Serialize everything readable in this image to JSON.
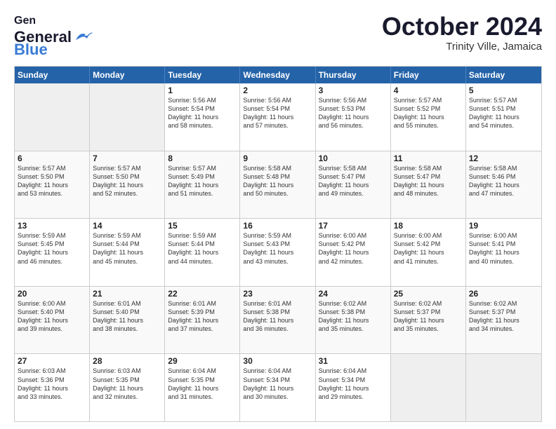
{
  "header": {
    "logo_line1": "General",
    "logo_line2": "Blue",
    "month_title": "October 2024",
    "location": "Trinity Ville, Jamaica"
  },
  "weekdays": [
    "Sunday",
    "Monday",
    "Tuesday",
    "Wednesday",
    "Thursday",
    "Friday",
    "Saturday"
  ],
  "rows": [
    [
      {
        "day": "",
        "info": ""
      },
      {
        "day": "",
        "info": ""
      },
      {
        "day": "1",
        "info": "Sunrise: 5:56 AM\nSunset: 5:54 PM\nDaylight: 11 hours\nand 58 minutes."
      },
      {
        "day": "2",
        "info": "Sunrise: 5:56 AM\nSunset: 5:54 PM\nDaylight: 11 hours\nand 57 minutes."
      },
      {
        "day": "3",
        "info": "Sunrise: 5:56 AM\nSunset: 5:53 PM\nDaylight: 11 hours\nand 56 minutes."
      },
      {
        "day": "4",
        "info": "Sunrise: 5:57 AM\nSunset: 5:52 PM\nDaylight: 11 hours\nand 55 minutes."
      },
      {
        "day": "5",
        "info": "Sunrise: 5:57 AM\nSunset: 5:51 PM\nDaylight: 11 hours\nand 54 minutes."
      }
    ],
    [
      {
        "day": "6",
        "info": "Sunrise: 5:57 AM\nSunset: 5:50 PM\nDaylight: 11 hours\nand 53 minutes."
      },
      {
        "day": "7",
        "info": "Sunrise: 5:57 AM\nSunset: 5:50 PM\nDaylight: 11 hours\nand 52 minutes."
      },
      {
        "day": "8",
        "info": "Sunrise: 5:57 AM\nSunset: 5:49 PM\nDaylight: 11 hours\nand 51 minutes."
      },
      {
        "day": "9",
        "info": "Sunrise: 5:58 AM\nSunset: 5:48 PM\nDaylight: 11 hours\nand 50 minutes."
      },
      {
        "day": "10",
        "info": "Sunrise: 5:58 AM\nSunset: 5:47 PM\nDaylight: 11 hours\nand 49 minutes."
      },
      {
        "day": "11",
        "info": "Sunrise: 5:58 AM\nSunset: 5:47 PM\nDaylight: 11 hours\nand 48 minutes."
      },
      {
        "day": "12",
        "info": "Sunrise: 5:58 AM\nSunset: 5:46 PM\nDaylight: 11 hours\nand 47 minutes."
      }
    ],
    [
      {
        "day": "13",
        "info": "Sunrise: 5:59 AM\nSunset: 5:45 PM\nDaylight: 11 hours\nand 46 minutes."
      },
      {
        "day": "14",
        "info": "Sunrise: 5:59 AM\nSunset: 5:44 PM\nDaylight: 11 hours\nand 45 minutes."
      },
      {
        "day": "15",
        "info": "Sunrise: 5:59 AM\nSunset: 5:44 PM\nDaylight: 11 hours\nand 44 minutes."
      },
      {
        "day": "16",
        "info": "Sunrise: 5:59 AM\nSunset: 5:43 PM\nDaylight: 11 hours\nand 43 minutes."
      },
      {
        "day": "17",
        "info": "Sunrise: 6:00 AM\nSunset: 5:42 PM\nDaylight: 11 hours\nand 42 minutes."
      },
      {
        "day": "18",
        "info": "Sunrise: 6:00 AM\nSunset: 5:42 PM\nDaylight: 11 hours\nand 41 minutes."
      },
      {
        "day": "19",
        "info": "Sunrise: 6:00 AM\nSunset: 5:41 PM\nDaylight: 11 hours\nand 40 minutes."
      }
    ],
    [
      {
        "day": "20",
        "info": "Sunrise: 6:00 AM\nSunset: 5:40 PM\nDaylight: 11 hours\nand 39 minutes."
      },
      {
        "day": "21",
        "info": "Sunrise: 6:01 AM\nSunset: 5:40 PM\nDaylight: 11 hours\nand 38 minutes."
      },
      {
        "day": "22",
        "info": "Sunrise: 6:01 AM\nSunset: 5:39 PM\nDaylight: 11 hours\nand 37 minutes."
      },
      {
        "day": "23",
        "info": "Sunrise: 6:01 AM\nSunset: 5:38 PM\nDaylight: 11 hours\nand 36 minutes."
      },
      {
        "day": "24",
        "info": "Sunrise: 6:02 AM\nSunset: 5:38 PM\nDaylight: 11 hours\nand 35 minutes."
      },
      {
        "day": "25",
        "info": "Sunrise: 6:02 AM\nSunset: 5:37 PM\nDaylight: 11 hours\nand 35 minutes."
      },
      {
        "day": "26",
        "info": "Sunrise: 6:02 AM\nSunset: 5:37 PM\nDaylight: 11 hours\nand 34 minutes."
      }
    ],
    [
      {
        "day": "27",
        "info": "Sunrise: 6:03 AM\nSunset: 5:36 PM\nDaylight: 11 hours\nand 33 minutes."
      },
      {
        "day": "28",
        "info": "Sunrise: 6:03 AM\nSunset: 5:35 PM\nDaylight: 11 hours\nand 32 minutes."
      },
      {
        "day": "29",
        "info": "Sunrise: 6:04 AM\nSunset: 5:35 PM\nDaylight: 11 hours\nand 31 minutes."
      },
      {
        "day": "30",
        "info": "Sunrise: 6:04 AM\nSunset: 5:34 PM\nDaylight: 11 hours\nand 30 minutes."
      },
      {
        "day": "31",
        "info": "Sunrise: 6:04 AM\nSunset: 5:34 PM\nDaylight: 11 hours\nand 29 minutes."
      },
      {
        "day": "",
        "info": ""
      },
      {
        "day": "",
        "info": ""
      }
    ]
  ]
}
